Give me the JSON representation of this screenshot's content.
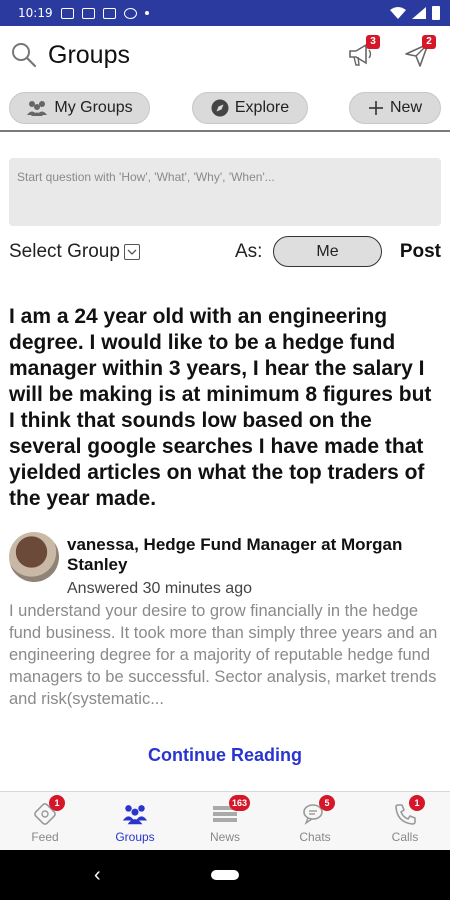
{
  "status_bar": {
    "time": "10:19"
  },
  "header": {
    "title": "Groups",
    "notifications_badge": "3",
    "messages_badge": "2"
  },
  "pills": {
    "my_groups": "My Groups",
    "explore": "Explore",
    "new": "New"
  },
  "composer": {
    "placeholder": "Start question with 'How', 'What', 'Why', 'When'...",
    "select_group_label": "Select Group",
    "as_label": "As:",
    "as_value": "Me",
    "post_label": "Post"
  },
  "question": {
    "text": "I am a 24 year old with an engineering degree. I would like to be a hedge fund manager within 3 years, I hear the salary I will be making is at minimum 8 figures but I think that sounds low based on the several google searches I have made that yielded articles on what the top traders of the year made."
  },
  "answer": {
    "author": "vanessa, Hedge Fund Manager at Morgan Stanley",
    "time": "Answered 30 minutes ago",
    "text": "I understand your desire to grow financially in the hedge fund business. It took more than simply three years and an engineering degree for a majority of reputable hedge fund managers to be successful. Sector analysis, market trends and risk(systematic..."
  },
  "continue_reading": "Continue Reading",
  "bottom_nav": [
    {
      "label": "Feed",
      "badge": "1",
      "icon": "feed-icon"
    },
    {
      "label": "Groups",
      "badge": "",
      "icon": "groups-icon"
    },
    {
      "label": "News",
      "badge": "163",
      "icon": "news-icon"
    },
    {
      "label": "Chats",
      "badge": "5",
      "icon": "chats-icon"
    },
    {
      "label": "Calls",
      "badge": "1",
      "icon": "calls-icon"
    }
  ],
  "colors": {
    "status_bar": "#2b3a9f",
    "accent": "#2a35cf",
    "badge": "#d6172a"
  }
}
